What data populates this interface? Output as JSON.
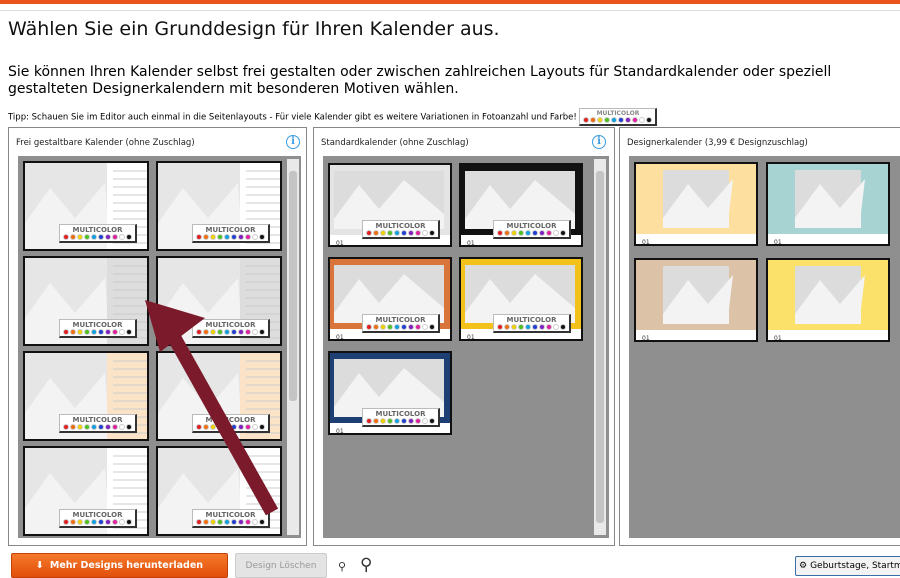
{
  "title": "Wählen Sie ein Grunddesign für Ihren Kalender aus.",
  "intro": "Sie können Ihren Kalender selbst frei gestalten oder zwischen zahlreichen Layouts für Standardkalender oder speziell gestalteten Designerkalendern mit besonderen Motiven wählen.",
  "tip": "Tipp: Schauen Sie im Editor auch einmal in die Seitenlayouts - Für viele Kalender gibt es weitere Variationen in Fotoanzahl und Farbe!",
  "badge": "MULTICOLOR",
  "dot_colors": [
    "#e02020",
    "#f07010",
    "#f0d000",
    "#50c020",
    "#10a0e0",
    "#2040d0",
    "#8020c0",
    "#e020a0",
    "#ffffff",
    "#111111"
  ],
  "panels": [
    {
      "title": "Frei gestaltbare Kalender (ohne Zuschlag)",
      "thumbs": [
        {
          "bg": "#e4e4e4",
          "side": "#fff"
        },
        {
          "bg": "#e4e4e4",
          "side": "#fff"
        },
        {
          "bg": "#e4e4e4",
          "side": "#ddd"
        },
        {
          "bg": "#e4e4e4",
          "side": "#ddd"
        },
        {
          "bg": "#e4e4e4",
          "side": "#fbe3c8"
        },
        {
          "bg": "#e4e4e4",
          "side": "#fbe3c8"
        },
        {
          "bg": "#e4e4e4",
          "side": "#fff"
        },
        {
          "bg": "#e4e4e4",
          "side": "#fff"
        }
      ]
    },
    {
      "title": "Standardkalender (ohne Zuschlag)",
      "thumbs": [
        {
          "bg": "#e4e4e4",
          "side": ""
        },
        {
          "bg": "#111",
          "side": ""
        },
        {
          "bg": "#d9743a",
          "side": ""
        },
        {
          "bg": "#f2c21a",
          "side": ""
        },
        {
          "bg": "#1d3f73",
          "side": ""
        }
      ]
    },
    {
      "title": "Designerkalender (3,99 € Designzuschlag)",
      "thumbs": [
        {
          "bg": "#fde0a0",
          "side": ""
        },
        {
          "bg": "#a8d3d3",
          "side": ""
        },
        {
          "bg": "#dcc2a6",
          "side": ""
        },
        {
          "bg": "#fbe06a",
          "side": ""
        }
      ]
    }
  ],
  "buttons": {
    "download": "Mehr Designs herunterladen",
    "delete": "Design Löschen",
    "settings": "Geburtstage, Startmonat"
  }
}
